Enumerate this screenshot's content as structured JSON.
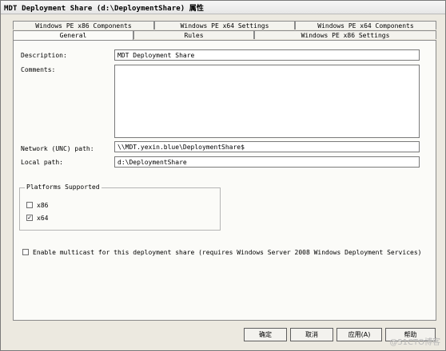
{
  "window": {
    "title": "MDT Deployment Share (d:\\DeploymentShare) 属性"
  },
  "tabs": {
    "row1": [
      "Windows PE x86 Components",
      "Windows PE x64 Settings",
      "Windows PE x64 Components"
    ],
    "row2": [
      "General",
      "Rules",
      "Windows PE x86 Settings"
    ]
  },
  "general": {
    "description_label": "Description:",
    "description_value": "MDT Deployment Share",
    "comments_label": "Comments:",
    "comments_value": "",
    "unc_label": "Network (UNC) path:",
    "unc_value": "\\\\MDT.yexin.blue\\DeploymentShare$",
    "local_label": "Local path:",
    "local_value": "d:\\DeploymentShare",
    "platforms_title": "Platforms Supported",
    "x86_label": "x86",
    "x86_checked": false,
    "x64_label": "x64",
    "x64_checked": true,
    "multicast_label": "Enable multicast for this deployment share (requires Windows Server 2008 Windows Deployment Services)",
    "multicast_checked": false
  },
  "buttons": {
    "ok": "确定",
    "cancel": "取消",
    "apply": "应用(A)",
    "help": "帮助"
  },
  "watermark": "@51CTO博客"
}
